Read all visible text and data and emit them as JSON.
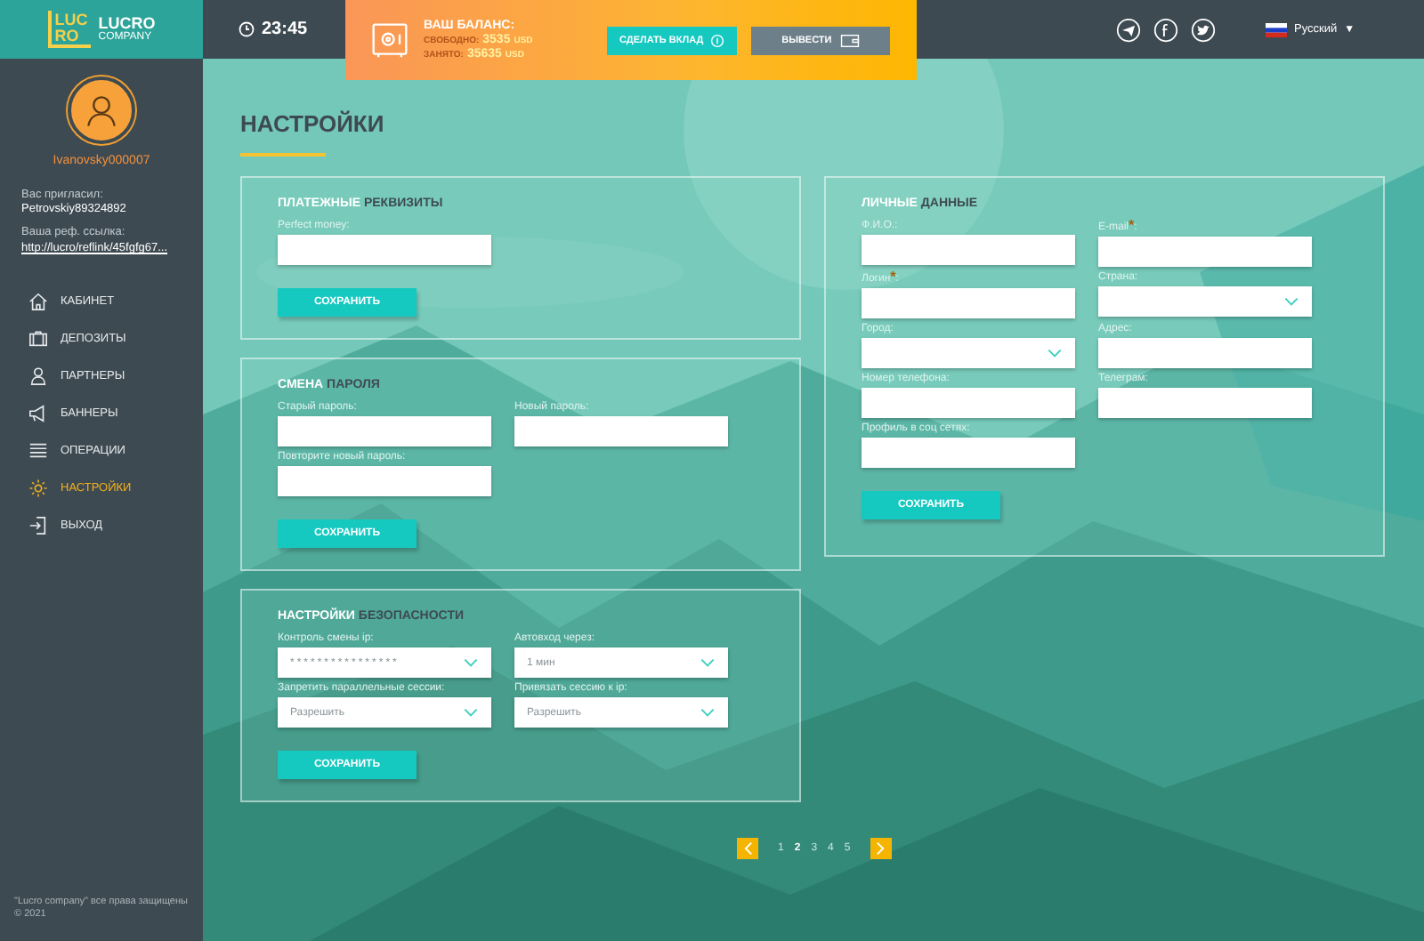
{
  "logo": {
    "mark_top": "LUC",
    "mark_bottom": "RO",
    "name": "LUCRO",
    "sub": "COMPANY"
  },
  "clock": "23:45",
  "balance": {
    "title": "ВАШ БАЛАНС:",
    "free_label": "СВОБОДНО:",
    "free_value": "3535",
    "free_unit": "USD",
    "busy_label": "ЗАНЯТО:",
    "busy_value": "35635",
    "busy_unit": "USD",
    "deposit_button": "СДЕЛАТЬ ВКЛАД",
    "withdraw_button": "ВЫВЕСТИ"
  },
  "language": {
    "label": "Русский",
    "caret": "▼"
  },
  "user": {
    "name": "Ivanovsky000007",
    "invited_label": "Вас пригласил:",
    "invited_by": "Petrovskiy89324892",
    "ref_label": "Ваша реф. ссылка:",
    "ref_link": "http://lucro/reflink/45fgfg67..."
  },
  "nav": [
    {
      "label": "КАБИНЕТ",
      "selected": false
    },
    {
      "label": "ДЕПОЗИТЫ",
      "selected": false
    },
    {
      "label": "ПАРТНЕРЫ",
      "selected": false
    },
    {
      "label": "БАННЕРЫ",
      "selected": false
    },
    {
      "label": "ОПЕРАЦИИ",
      "selected": false
    },
    {
      "label": "НАСТРОЙКИ",
      "selected": true
    },
    {
      "label": "ВЫХОД",
      "selected": false
    }
  ],
  "footer": "\"Lucro company\" все права защищены © 2021",
  "page_title": "НАСТРОЙКИ",
  "left_sections": [
    {
      "title_light": "ПЛАТЕЖНЫЕ",
      "title_dark": "РЕКВИЗИТЫ",
      "button": "СОХРАНИТЬ",
      "fields": [
        {
          "kind": "input",
          "label": "Perfect money:"
        }
      ]
    },
    {
      "title_light": "СМЕНА",
      "title_dark": "ПАРОЛЯ",
      "button": "СОХРАНИТЬ",
      "fields": [
        {
          "kind": "input",
          "label": "Старый пароль:"
        },
        {
          "kind": "input",
          "label": "Новый пароль:"
        },
        {
          "kind": "input",
          "label": "Повторите новый пароль:"
        }
      ]
    },
    {
      "title_light": "НАСТРОЙКИ",
      "title_dark": "БЕЗОПАСНОСТИ",
      "button": "СОХРАНИТЬ",
      "fields": [
        {
          "kind": "select",
          "label": "Контроль смены ip:",
          "value": "****************"
        },
        {
          "kind": "select",
          "label": "Автовход через:",
          "value": "1 мин"
        },
        {
          "kind": "select",
          "label": "Запретить параллельные сессии:",
          "value": "Разрешить"
        },
        {
          "kind": "select",
          "label": "Привязать сессию к ip:",
          "value": "Разрешить"
        }
      ]
    }
  ],
  "right_sections": [
    {
      "title_light": "ЛИЧНЫЕ",
      "title_dark": "ДАННЫЕ",
      "button": "СОХРАНИТЬ",
      "fields": [
        {
          "kind": "input",
          "label": "Ф.И.О.:"
        },
        {
          "kind": "input",
          "label": "E-mail",
          "star": "*",
          "tail": ":"
        },
        {
          "kind": "input",
          "label": "Логин",
          "star": "*",
          "tail": ":"
        },
        {
          "kind": "select",
          "label": "Страна:"
        },
        {
          "kind": "select",
          "label": "Город:"
        },
        {
          "kind": "input",
          "label": "Адрес:"
        },
        {
          "kind": "input",
          "label": "Номер телефона:"
        },
        {
          "kind": "input",
          "label": "Телеграм:"
        },
        {
          "kind": "input",
          "label": "Профиль в соц сетях:"
        }
      ]
    }
  ],
  "pagination": {
    "pages": [
      {
        "label": "1",
        "selected": false
      },
      {
        "label": "2",
        "selected": true
      },
      {
        "label": "3",
        "selected": false
      },
      {
        "label": "4",
        "selected": false
      },
      {
        "label": "5",
        "selected": false
      }
    ]
  }
}
